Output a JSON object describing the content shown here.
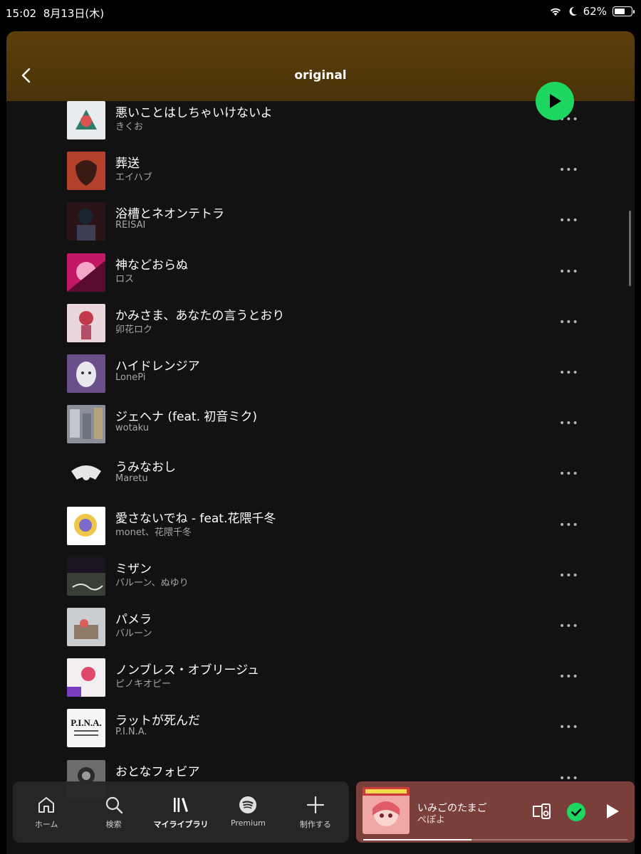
{
  "status_bar": {
    "time": "15:02",
    "date": "8月13日(木)",
    "battery": "62%",
    "battery_level": 0.62
  },
  "playlist": {
    "title": "original"
  },
  "tracks": [
    {
      "title": "悪いことはしちゃいけないよ",
      "artist": "きくお",
      "cover_color": "#e9ecef"
    },
    {
      "title": "葬送",
      "artist": "エイハブ",
      "cover_color": "#b2402a"
    },
    {
      "title": "浴槽とネオンテトラ",
      "artist": "REISAI",
      "cover_color": "#2b1418"
    },
    {
      "title": "神などおらぬ",
      "artist": "ロス",
      "cover_color": "#c21764"
    },
    {
      "title": "かみさま、あなたの言うとおり",
      "artist": "卯花ロク",
      "cover_color": "#e9d6db"
    },
    {
      "title": "ハイドレンジア",
      "artist": "LonePi",
      "cover_color": "#6b4f8a"
    },
    {
      "title": "ジェヘナ (feat. 初音ミク)",
      "artist": "wotaku",
      "cover_color": "#8a8f99"
    },
    {
      "title": "うみなおし",
      "artist": "Maretu",
      "cover_color": "#111111"
    },
    {
      "title": "愛さないでね - feat.花隈千冬",
      "artist": "monet、花隈千冬",
      "cover_color": "#f0c64a"
    },
    {
      "title": "ミザン",
      "artist": "バルーン、ぬゆり",
      "cover_color": "#3a3f36"
    },
    {
      "title": "パメラ",
      "artist": "バルーン",
      "cover_color": "#c9cdd0"
    },
    {
      "title": "ノンブレス・オブリージュ",
      "artist": "ピノキオピー",
      "cover_color": "#f2eef2"
    },
    {
      "title": "ラットが死んだ",
      "artist": "P.I.N.A.",
      "cover_color": "#f5f5f5"
    },
    {
      "title": "おとなフォビア",
      "artist": "",
      "cover_color": "#6d6d6d"
    }
  ],
  "nav": [
    {
      "label": "ホーム",
      "icon": "home-icon"
    },
    {
      "label": "検索",
      "icon": "search-icon"
    },
    {
      "label": "マイライブラリ",
      "icon": "library-icon"
    },
    {
      "label": "Premium",
      "icon": "spotify-icon"
    },
    {
      "label": "制作する",
      "icon": "plus-icon"
    }
  ],
  "now_playing": {
    "title": "いみごのたまご",
    "artist": "ぺぽよ",
    "progress": 0.41,
    "cover_color": "#f1a7a3"
  },
  "colors": {
    "accent": "#1ed760",
    "header": "#5e3f0b",
    "panel": "#121212",
    "np_bg": "#7a3f3a"
  }
}
